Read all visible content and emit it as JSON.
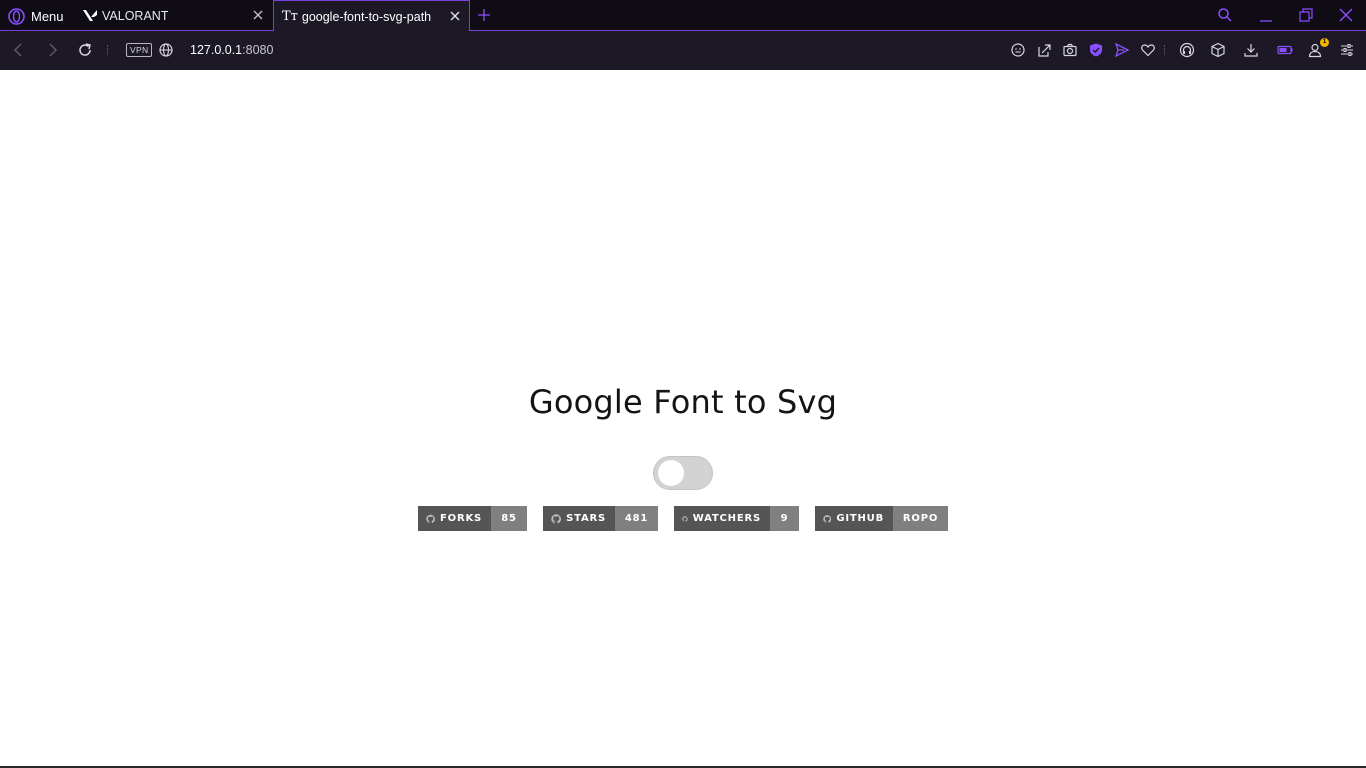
{
  "browser": {
    "menu_label": "Menu",
    "tabs": [
      {
        "title": "VALORANT",
        "active": false
      },
      {
        "title": "google-font-to-svg-path",
        "active": true,
        "favicon_text": "Tт"
      }
    ],
    "vpn_label": "VPN",
    "url_host": "127.0.0.1",
    "url_port": ":8080",
    "accent_color": "#7a3fd6",
    "notification_count": "1",
    "toolbar_icons": [
      "emoji-icon",
      "share-icon",
      "camera-icon",
      "shield-icon",
      "send-icon",
      "heart-icon",
      "headset-icon",
      "cube-icon",
      "download-icon",
      "battery-icon",
      "profile-icon",
      "settings-icon"
    ]
  },
  "page": {
    "title": "Google Font to Svg",
    "toggle_on": false,
    "badges": [
      {
        "label": "FORKS",
        "count": "85"
      },
      {
        "label": "STARS",
        "count": "481"
      },
      {
        "label": "WATCHERS",
        "count": "9"
      },
      {
        "label": "GITHUB",
        "count": "ROPO"
      }
    ]
  }
}
